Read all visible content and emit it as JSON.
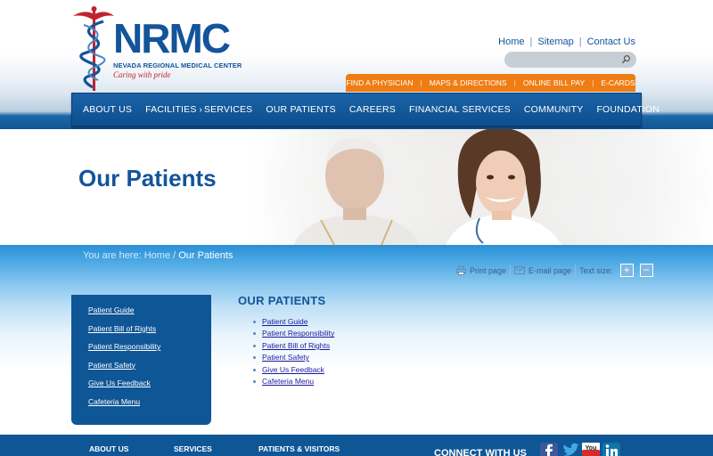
{
  "logo": {
    "name": "NRMC",
    "subtitle": "NEVADA REGIONAL MEDICAL CENTER",
    "tagline": "Caring with pride"
  },
  "utility_links": [
    "Home",
    "Sitemap",
    "Contact Us"
  ],
  "search": {
    "placeholder": ""
  },
  "quick_links": [
    "FIND A PHYSICIAN",
    "MAPS & DIRECTIONS",
    "ONLINE BILL PAY",
    "E-CARDS"
  ],
  "main_nav": [
    "ABOUT US",
    "FACILITIES",
    "SERVICES",
    "OUR PATIENTS",
    "CAREERS",
    "FINANCIAL SERVICES",
    "COMMUNITY",
    "FOUNDATION"
  ],
  "hero": {
    "title": "Our Patients"
  },
  "breadcrumb": {
    "prefix": "You are here:",
    "home": "Home",
    "separator": "/",
    "current": "Our Patients"
  },
  "tools": {
    "print": "Print page",
    "email": "E-mail page",
    "text_size": "Text size:",
    "increase": "+",
    "decrease": "−"
  },
  "sidebar": [
    "Patient Guide",
    "Patient Bill of Rights",
    "Patient Responsibility",
    "Patient Safety",
    "Give Us Feedback",
    "Cafeteria Menu"
  ],
  "content": {
    "title": "OUR PATIENTS",
    "links": [
      "Patient Guide",
      "Patient Responsibility",
      "Patient Bill of Rights",
      "Patient Safety",
      "Give Us Feedback",
      "Cafeteria Menu"
    ]
  },
  "footer": {
    "columns": [
      "ABOUT US",
      "SERVICES",
      "PATIENTS & VISITORS"
    ],
    "connect_label": "CONNECT WITH US",
    "social_icons": [
      "facebook-icon",
      "twitter-icon",
      "youtube-icon",
      "linkedin-icon"
    ]
  },
  "colors": {
    "brand_blue": "#13549a",
    "nav_blue": "#0f5697",
    "accent_orange": "#ef7d14",
    "logo_red": "#c0222e"
  }
}
